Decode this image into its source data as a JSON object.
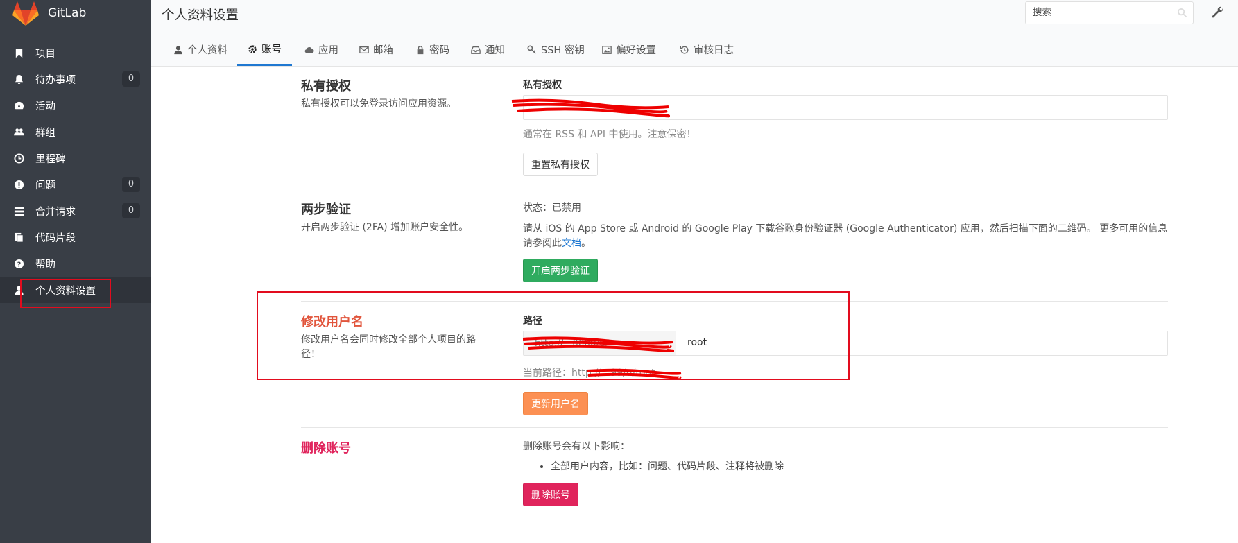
{
  "brand": "GitLab",
  "sidebar": {
    "items": [
      {
        "label": "项目",
        "icon": "bookmark-icon"
      },
      {
        "label": "待办事项",
        "icon": "bell-icon",
        "count": "0"
      },
      {
        "label": "活动",
        "icon": "dashboard-icon"
      },
      {
        "label": "群组",
        "icon": "users-icon"
      },
      {
        "label": "里程碑",
        "icon": "clock-icon"
      },
      {
        "label": "问题",
        "icon": "exclamation-circle-icon",
        "count": "0"
      },
      {
        "label": "合并请求",
        "icon": "tasks-icon",
        "count": "0"
      },
      {
        "label": "代码片段",
        "icon": "clipboard-icon"
      },
      {
        "label": "帮助",
        "icon": "question-circle-icon"
      },
      {
        "label": "个人资料设置",
        "icon": "user-icon",
        "active": true
      }
    ]
  },
  "header": {
    "title": "个人资料设置",
    "search_placeholder": "搜索"
  },
  "tabs": [
    {
      "label": "个人资料",
      "icon": "user-icon"
    },
    {
      "label": "账号",
      "icon": "gear-icon",
      "active": true
    },
    {
      "label": "应用",
      "icon": "cloud-icon"
    },
    {
      "label": "邮箱",
      "icon": "envelope-icon"
    },
    {
      "label": "密码",
      "icon": "lock-icon"
    },
    {
      "label": "通知",
      "icon": "inbox-icon"
    },
    {
      "label": "SSH 密钥",
      "icon": "key-icon"
    },
    {
      "label": "偏好设置",
      "icon": "image-icon"
    },
    {
      "label": "审核日志",
      "icon": "history-icon"
    }
  ],
  "private_token": {
    "title": "私有授权",
    "desc": "私有授权可以免登录访问应用资源。",
    "field_label": "私有授权",
    "help": "通常在 RSS 和 API 中使用。注意保密！",
    "reset_button": "重置私有授权"
  },
  "two_factor": {
    "title": "两步验证",
    "desc": "开启两步验证 (2FA) 增加账户安全性。",
    "status": "状态：已禁用",
    "instructions": "请从 iOS 的 App Store 或 Android 的 Google Play 下载谷歌身份验证器 (Google Authenticator) 应用，然后扫描下面的二维码。 更多可用的信息请参阅此",
    "doc_link": "文档",
    "period": "。",
    "enable_button": "开启两步验证"
  },
  "change_username": {
    "title": "修改用户名",
    "desc": "修改用户名会同时修改全部个人项目的路径！",
    "path_label": "路径",
    "prefix_visible": "http://...0000/u/",
    "path_value": "root",
    "current_path_label": "当前路径：",
    "current_path_visible": "http://...99/u/root",
    "update_button": "更新用户名",
    "colors": {
      "title": "#e1553c"
    }
  },
  "delete_account": {
    "title": "删除账号",
    "consequences": "删除账号会有以下影响：",
    "items": [
      "全部用户内容，比如：问题、代码片段、注释将被删除"
    ],
    "delete_button": "删除账号",
    "colors": {
      "title": "#e0245c"
    }
  },
  "colors": {
    "sidebar_bg": "#393e46",
    "accent": "#1f78d1",
    "annotation": "#e20c1e"
  }
}
